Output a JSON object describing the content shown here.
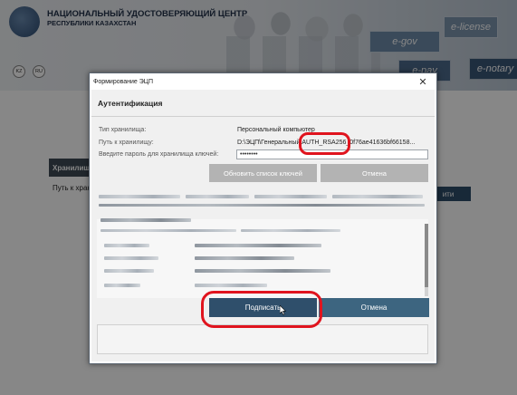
{
  "background": {
    "logo_title": "НАЦИОНАЛЬНЫЙ УДОСТОВЕРЯЮЩИЙ ЦЕНТР",
    "logo_subtitle": "РЕСПУБЛИКИ КАЗАХСТАН",
    "tiles": [
      "e-gov",
      "e-license",
      "e-pay",
      "e-notary"
    ],
    "lang_buttons": [
      "KZ",
      "RU"
    ],
    "table_header": "Хранилище",
    "table_row": "Путь к хран",
    "right_button": "ити"
  },
  "window": {
    "title": "Формирование ЭЦП",
    "close_glyph": "✕",
    "header": "Аутентификация",
    "fields": {
      "storage_type_label": "Тип хранилища:",
      "storage_type_value": "Персональный компьютер",
      "path_label": "Путь к хранилищу:",
      "path_value": "D:\\ЭЦП\\Генеральный\\AUTH_RSA256_0f76ae41636bf66158...",
      "password_label": "Введите пароль для хранилища ключей:",
      "password_value": "••••••••"
    },
    "buttons": {
      "refresh_keys": "Обновить список ключей",
      "cancel_top": "Отмена",
      "sign": "Подписать",
      "cancel": "Отмена"
    }
  },
  "annotations": {
    "color": "#e0141e"
  },
  "colors": {
    "primary_button": "#2f4f6b",
    "secondary_button": "#3d6580",
    "disabled_button": "#b3b3b3"
  }
}
